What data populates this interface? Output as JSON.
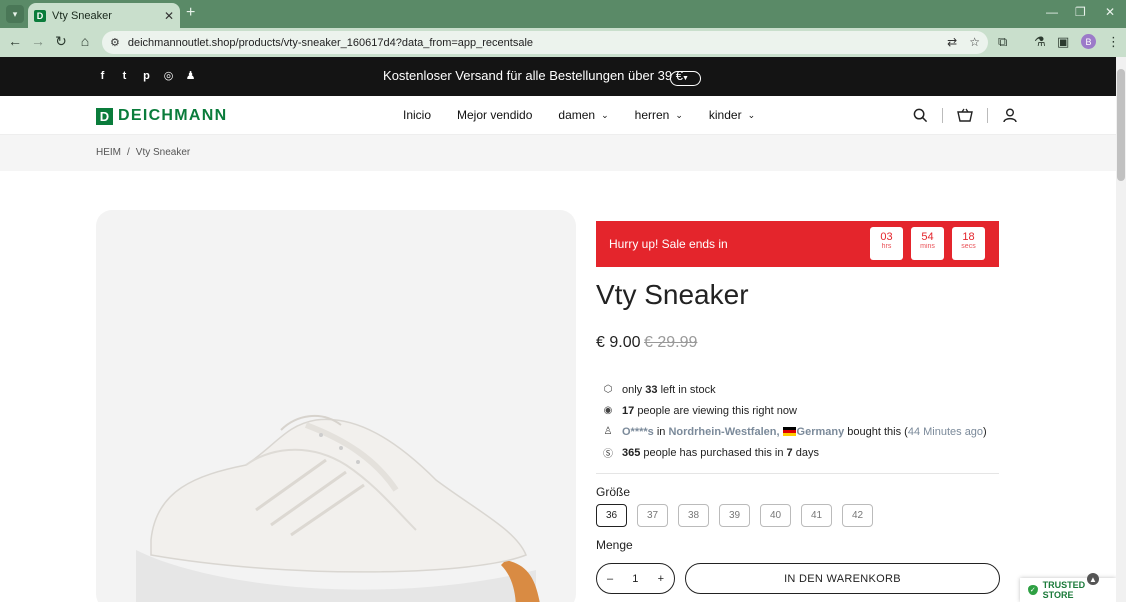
{
  "browser": {
    "tab_title": "Vty Sneaker",
    "tab_favicon": "D",
    "url": "deichmannoutlet.shop/products/vty-sneaker_160617d4?data_from=app_recentsale",
    "profile_initial": "B"
  },
  "promo": {
    "text": "Kostenloser Versand für alle Bestellungen über 39 €",
    "socials": [
      "facebook-icon",
      "twitter-icon",
      "pinterest-icon",
      "instagram-icon",
      "snapchat-icon"
    ]
  },
  "header": {
    "logo_mark": "D",
    "logo_text": "DEICHMANN",
    "nav": [
      {
        "label": "Inicio"
      },
      {
        "label": "Mejor vendido"
      },
      {
        "label": "damen"
      },
      {
        "label": "herren"
      },
      {
        "label": "kinder"
      }
    ]
  },
  "breadcrumb": {
    "home": "HEIM",
    "separator": "/",
    "current": "Vty Sneaker"
  },
  "countdown": {
    "label": "Hurry up!  Sale ends in",
    "hours": "03",
    "hours_unit": "hrs",
    "mins": "54",
    "mins_unit": "mins",
    "secs": "18",
    "secs_unit": "secs",
    "color": "#e4252c"
  },
  "product": {
    "title": "Vty Sneaker",
    "price": "€ 9.00",
    "old_price": "€ 29.99"
  },
  "info": {
    "stock_pre": "only",
    "stock_count": "33",
    "stock_post": "left in stock",
    "viewers_count": "17",
    "viewers_post": "people are viewing this right now",
    "buyer_name": "O****s",
    "buyer_in": "in",
    "buyer_region": "Nordrhein-Westfalen,",
    "buyer_country": "Germany",
    "buyer_post": "bought this (",
    "buyer_time": "44 Minutes ago",
    "buyer_close": ")",
    "purchased_count": "365",
    "purchased_mid": "people has purchased this in",
    "purchased_days": "7",
    "purchased_post": "days"
  },
  "options": {
    "size_label": "Größe",
    "sizes": [
      "36",
      "37",
      "38",
      "39",
      "40",
      "41",
      "42"
    ],
    "selected_size": "36",
    "qty_label": "Menge",
    "qty_minus": "–",
    "qty_value": "1",
    "qty_plus": "+",
    "cart_button": "IN DEN WARENKORB"
  },
  "badge": {
    "trusted": "TRUSTED STORE"
  }
}
